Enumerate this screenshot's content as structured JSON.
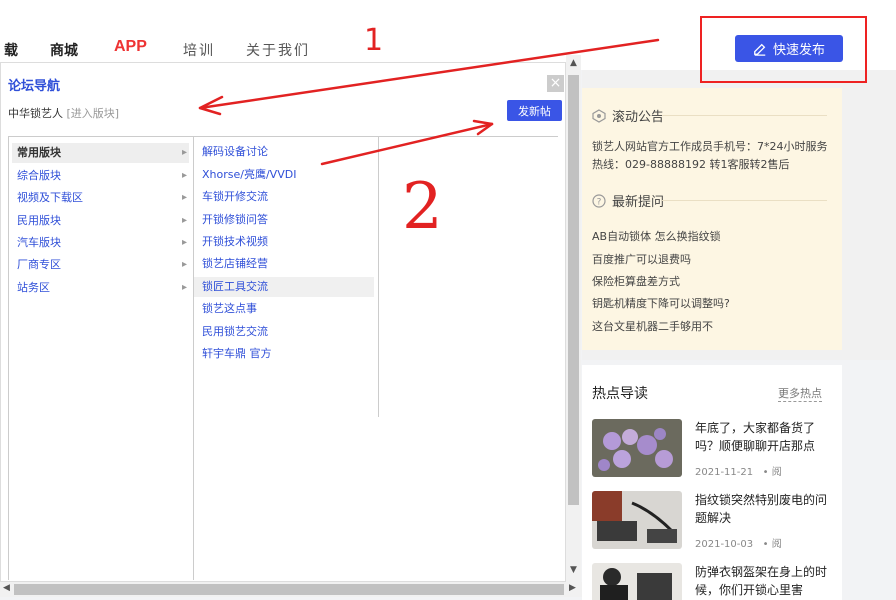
{
  "nav": {
    "items": [
      "载",
      "商城",
      "APP",
      "培训",
      "关于我们"
    ],
    "quick_post": "快速发布"
  },
  "dialog": {
    "title": "论坛导航",
    "close": "×",
    "forum_name": "中华锁艺人",
    "enter_link": "[进入版块]",
    "new_post": "发新帖",
    "categories": [
      "常用版块",
      "综合版块",
      "视频及下载区",
      "民用版块",
      "汽车版块",
      "厂商专区",
      "站务区"
    ],
    "subforums": [
      "解码设备讨论",
      "Xhorse/亮鹰/VVDI",
      "车锁开修交流",
      "开锁修锁问答",
      "开锁技术视频",
      "锁艺店铺经营",
      "锁匠工具交流",
      "锁艺这点事",
      "民用锁艺交流",
      "轩宇车鼎 官方"
    ]
  },
  "sidebar": {
    "notice_title": "滚动公告",
    "notice_text": "锁艺人网站官方工作成员手机号：7*24小时服务热线：029-88888192 转1客服转2售后",
    "questions_title": "最新提问",
    "questions": [
      "AB自动锁体 怎么换指纹锁",
      "百度推广可以退费吗",
      "保险柜算盘差方式",
      "钥匙机精度下降可以调整吗?",
      "这台文星机器二手够用不"
    ],
    "hot_title": "热点导读",
    "hot_more": "更多热点",
    "articles": [
      {
        "title": "年底了，大家都备货了吗？顺便聊聊开店那点",
        "date": "2021-11-21",
        "views": "阅"
      },
      {
        "title": "指纹锁突然特别废电的问题解决",
        "date": "2021-10-03",
        "views": "阅"
      },
      {
        "title": "防弹衣钢盔架在身上的时候，你们开锁心里害",
        "date": "",
        "views": ""
      }
    ]
  },
  "annotations": {
    "mark1": "1",
    "mark2": "2"
  },
  "colors": {
    "accent": "#3a55e6",
    "link": "#2f4fd8",
    "annotation": "#e22222",
    "notice_bg": "#fdf6e3"
  }
}
